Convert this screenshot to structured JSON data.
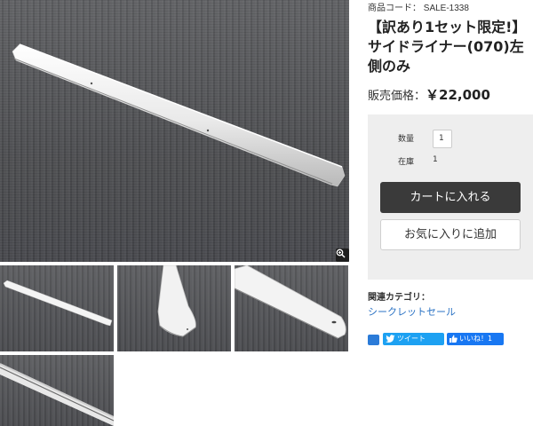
{
  "product": {
    "code_label": "商品コード：",
    "code_value": "SALE-1338",
    "title": "【訳あり1セット限定!】サイドライナー(070)左側のみ",
    "price_label": "販売価格：",
    "price_value": "￥22,000"
  },
  "cart": {
    "qty_label": "数量",
    "qty_value": "1",
    "stock_label": "在庫",
    "stock_value": "1",
    "add_to_cart": "カートに入れる",
    "add_to_favorites": "お気に入りに追加"
  },
  "related": {
    "heading": "関連カテゴリ：",
    "category_link": "シークレットセール"
  },
  "share": {
    "share_icon": "share-icon",
    "tweet_label": "ツイート",
    "like_label": "いいね！1"
  },
  "gallery": {
    "zoom_icon": "zoom-in-icon",
    "thumbnails": [
      "thumbnail-full-part",
      "thumbnail-end-cap",
      "thumbnail-tip-closeup",
      "thumbnail-edge-closeup"
    ]
  },
  "colors": {
    "link": "#2a72c4",
    "cart_button": "#3a3a3a",
    "panel_bg": "#eeeeee",
    "twitter": "#1da1f2",
    "facebook": "#1877f2"
  }
}
